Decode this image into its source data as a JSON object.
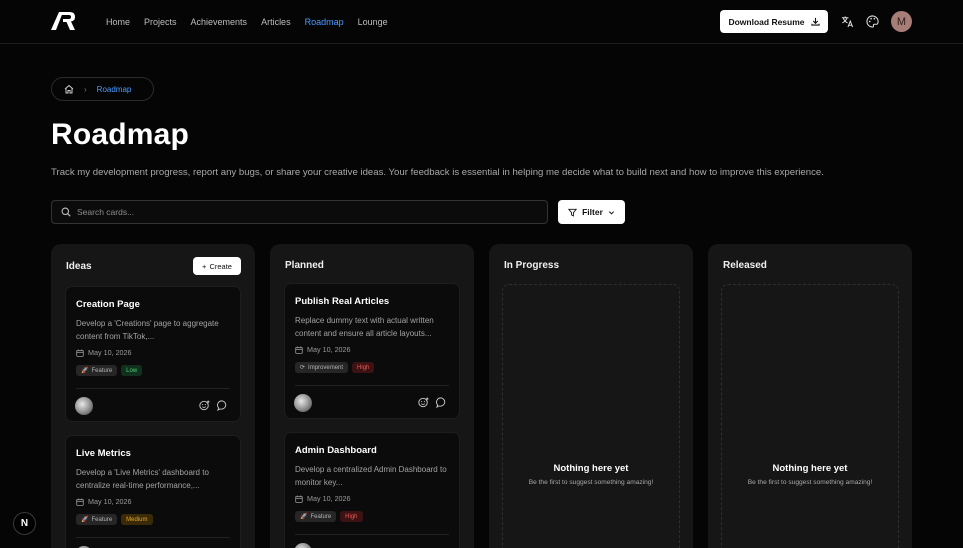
{
  "header": {
    "logo_icon": "ar-logo-icon",
    "nav": [
      {
        "label": "Home"
      },
      {
        "label": "Projects"
      },
      {
        "label": "Achievements"
      },
      {
        "label": "Articles"
      },
      {
        "label": "Roadmap",
        "active": true
      },
      {
        "label": "Lounge"
      }
    ],
    "download_label": "Download Resume",
    "avatar_initial": "M",
    "accent_color": "#4b9bff"
  },
  "breadcrumb": {
    "home_icon": "home-icon",
    "current": "Roadmap"
  },
  "page": {
    "title": "Roadmap",
    "description": "Track my development progress, report any bugs, or share your creative ideas. Your feedback is essential in helping me decide what to build next and how to improve this experience."
  },
  "search": {
    "placeholder": "Search cards..."
  },
  "filter": {
    "label": "Filter"
  },
  "columns": {
    "ideas": {
      "title": "Ideas",
      "create_label": "Create",
      "cards": [
        {
          "title": "Creation Page",
          "description": "Develop a 'Creations' page to aggregate content from TikTok,...",
          "date": "May 10, 2026",
          "type": "Feature",
          "priority": "Low"
        },
        {
          "title": "Live Metrics",
          "description": "Develop a 'Live Metrics' dashboard to centralize real-time performance,...",
          "date": "May 10, 2026",
          "type": "Feature",
          "priority": "Medium"
        }
      ]
    },
    "planned": {
      "title": "Planned",
      "cards": [
        {
          "title": "Publish Real Articles",
          "description": "Replace dummy text with actual written content and ensure all article layouts...",
          "date": "May 10, 2026",
          "type": "Improvement",
          "priority": "High"
        },
        {
          "title": "Admin Dashboard",
          "description": "Develop a centralized Admin Dashboard to monitor key...",
          "date": "May 10, 2026",
          "type": "Feature",
          "priority": "High"
        }
      ]
    },
    "in_progress": {
      "title": "In Progress",
      "empty_title": "Nothing here yet",
      "empty_subtitle": "Be the first to suggest something amazing!"
    },
    "released": {
      "title": "Released",
      "empty_title": "Nothing here yet",
      "empty_subtitle": "Be the first to suggest something amazing!"
    }
  },
  "dev_badge": {
    "label": "N"
  }
}
